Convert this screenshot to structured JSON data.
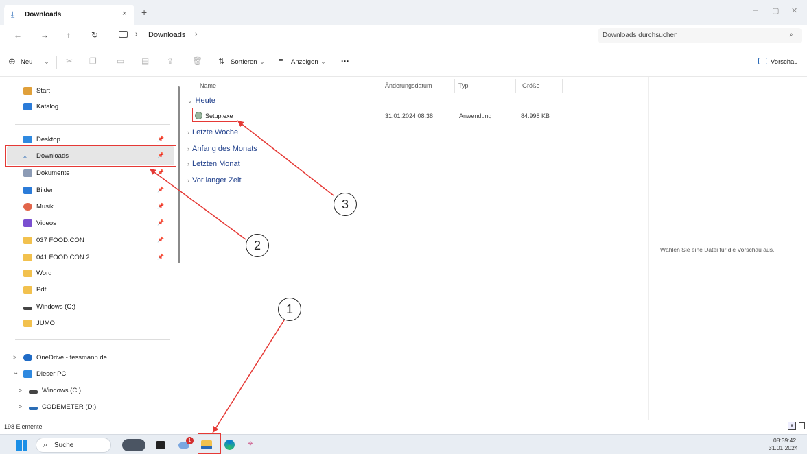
{
  "window": {
    "tab_title": "Downloads",
    "tab_close": "×",
    "new_tab": "+",
    "min": "–",
    "max": "▢",
    "close": "✕"
  },
  "address": {
    "crumb_arrow1": "›",
    "crumb_current": "Downloads",
    "crumb_arrow2": "›",
    "search_placeholder": "Downloads durchsuchen"
  },
  "toolbar": {
    "new_label": "Neu",
    "sort_label": "Sortieren",
    "view_label": "Anzeigen",
    "more_label": "···",
    "preview_label": "Vorschau"
  },
  "sidebar": {
    "top_items": [
      {
        "label": "Start",
        "icon": "home-icon",
        "color": "#e0a03a"
      },
      {
        "label": "Katalog",
        "icon": "gallery-icon",
        "color": "#2b7bd8"
      }
    ],
    "quick_items": [
      {
        "label": "Desktop",
        "icon": "desktop-icon",
        "color": "#2f89e0",
        "pinned": true
      },
      {
        "label": "Downloads",
        "icon": "download-icon",
        "color": "#2a6ab7",
        "pinned": true
      },
      {
        "label": "Dokumente",
        "icon": "document-icon",
        "color": "#8c9bb5",
        "pinned": true
      },
      {
        "label": "Bilder",
        "icon": "pictures-icon",
        "color": "#2b7bd8",
        "pinned": true
      },
      {
        "label": "Musik",
        "icon": "music-icon",
        "color": "#e2654a",
        "pinned": true
      },
      {
        "label": "Videos",
        "icon": "video-icon",
        "color": "#7a4fd0",
        "pinned": true
      },
      {
        "label": "037 FOOD.CON",
        "icon": "folder-icon",
        "color": "#f2c14e",
        "pinned": true
      },
      {
        "label": "041 FOOD.CON 2",
        "icon": "folder-icon",
        "color": "#f2c14e",
        "pinned": true
      },
      {
        "label": "Word",
        "icon": "folder-icon",
        "color": "#f2c14e",
        "pinned": false
      },
      {
        "label": "Pdf",
        "icon": "folder-icon",
        "color": "#f2c14e",
        "pinned": false
      },
      {
        "label": "Windows  (C:)",
        "icon": "drive-icon",
        "color": "#444444",
        "pinned": false
      },
      {
        "label": "JUMO",
        "icon": "folder-icon",
        "color": "#f2c14e",
        "pinned": false
      }
    ],
    "tree_items": [
      {
        "label": "OneDrive - fessmann.de",
        "chevron": ">",
        "icon": "cloud-icon"
      },
      {
        "label": "Dieser PC",
        "chevron": "⌄",
        "icon": "pc-icon"
      },
      {
        "label": "Windows  (C:)",
        "chevron": ">",
        "icon": "drive-icon"
      },
      {
        "label": "CODEMETER (D:)",
        "chevron": ">",
        "icon": "usb-drive-icon"
      }
    ]
  },
  "content": {
    "columns": [
      "Name",
      "Änderungsdatum",
      "Typ",
      "Größe"
    ],
    "groups": [
      "Heute",
      "Letzte Woche",
      "Anfang des Monats",
      "Letzten Monat",
      "Vor langer Zeit"
    ],
    "file": {
      "name": "Setup.exe",
      "date": "31.01.2024 08:38",
      "type": "Anwendung",
      "size": "84.998 KB"
    }
  },
  "preview": {
    "message": "Wählen Sie eine Datei für die Vorschau aus."
  },
  "status": {
    "count": "198 Elemente"
  },
  "taskbar": {
    "search_label": "Suche",
    "time": "08:39:42",
    "date": "31.01.2024",
    "badge": "1"
  },
  "annotations": {
    "one": "1",
    "two": "2",
    "three": "3"
  },
  "colors": {
    "annotation_red": "#e53935",
    "group_text": "#1e3e8a"
  }
}
